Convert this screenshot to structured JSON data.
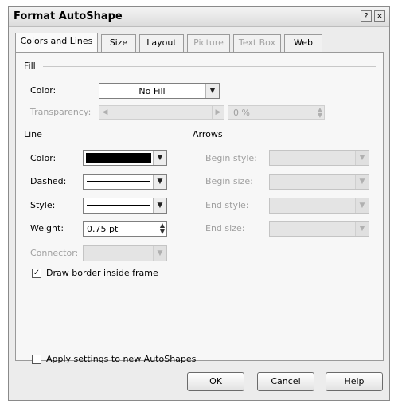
{
  "window": {
    "title": "Format AutoShape",
    "help_glyph": "?",
    "close_glyph": "×"
  },
  "tabs": [
    {
      "label": "Colors and Lines",
      "active": true,
      "enabled": true
    },
    {
      "label": "Size",
      "active": false,
      "enabled": true
    },
    {
      "label": "Layout",
      "active": false,
      "enabled": true
    },
    {
      "label": "Picture",
      "active": false,
      "enabled": false
    },
    {
      "label": "Text Box",
      "active": false,
      "enabled": false
    },
    {
      "label": "Web",
      "active": false,
      "enabled": true
    }
  ],
  "fill": {
    "section_label": "Fill",
    "color_label": "Color:",
    "color_value": "No Fill",
    "transparency_label": "Transparency:",
    "transparency_value": "0 %"
  },
  "line": {
    "section_label": "Line",
    "color_label": "Color:",
    "color_swatch": "#000000",
    "dashed_label": "Dashed:",
    "style_label": "Style:",
    "weight_label": "Weight:",
    "weight_value": "0.75 pt",
    "connector_label": "Connector:"
  },
  "arrows": {
    "section_label": "Arrows",
    "begin_style_label": "Begin style:",
    "begin_size_label": "Begin size:",
    "end_style_label": "End style:",
    "end_size_label": "End size:"
  },
  "options": {
    "draw_border_label": "Draw border inside frame",
    "draw_border_checked": true,
    "apply_label": "Apply settings to new AutoShapes",
    "apply_checked": false
  },
  "buttons": {
    "ok": "OK",
    "cancel": "Cancel",
    "help": "Help"
  },
  "icons": {
    "dropdown": "chevron-down-icon",
    "spin": "spinner-icon",
    "check": "checkmark-icon"
  }
}
